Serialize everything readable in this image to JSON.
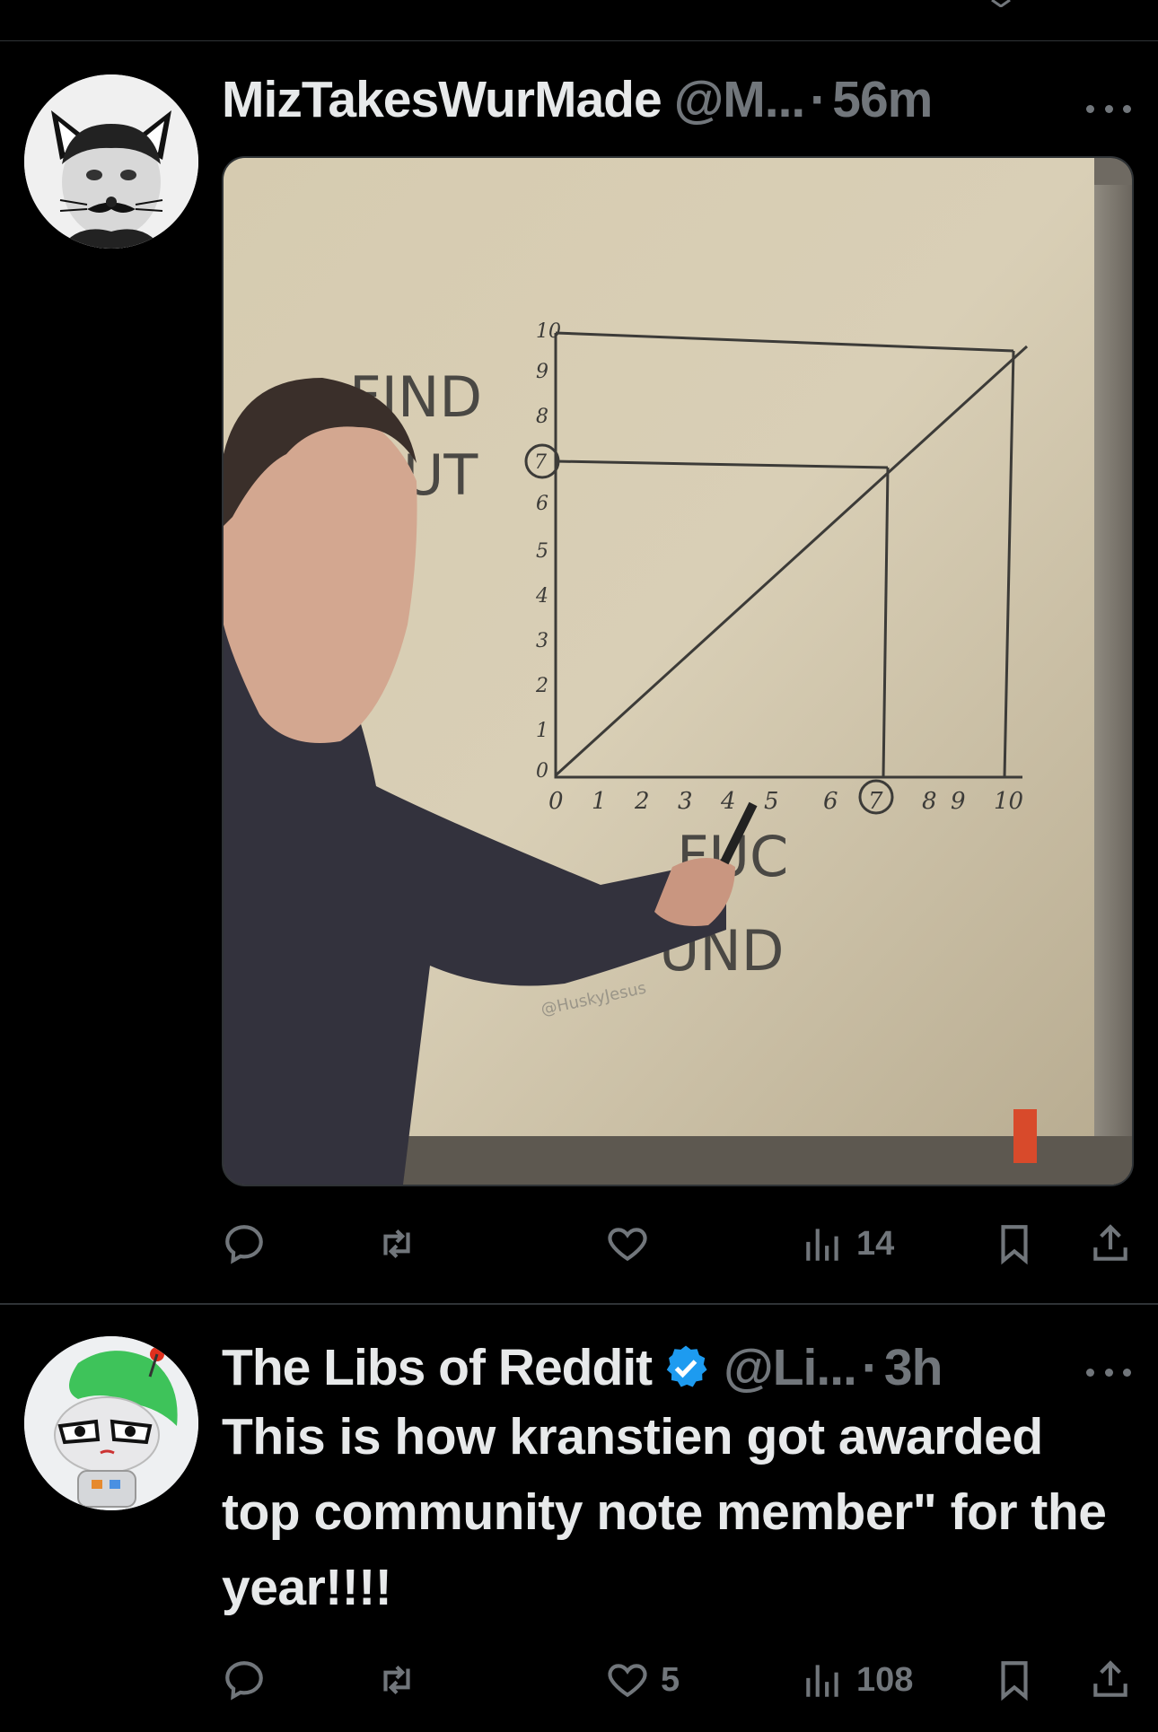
{
  "posts": [
    {
      "display_name": "MizTakesWurMade",
      "handle": "@M...",
      "time": "56m",
      "avatar_icon": "cat-ears-mustache-avatar",
      "media": {
        "board_words": [
          "FIND",
          "UT",
          "FUC",
          "UND"
        ],
        "axis_labels_y": [
          "10",
          "9",
          "8",
          "7",
          "6",
          "5",
          "4",
          "3",
          "2",
          "1",
          "0"
        ],
        "axis_labels_x": [
          "0",
          "1",
          "2",
          "3",
          "4",
          "5",
          "6",
          "7",
          "8",
          "9",
          "10"
        ],
        "watermark": "@HuskyJesus"
      },
      "actions": {
        "reply_count": "",
        "repost_count": "",
        "like_count": "",
        "views_count": "14"
      }
    },
    {
      "display_name": "The Libs of Reddit",
      "verified": true,
      "handle": "@Li...",
      "time": "3h",
      "avatar_icon": "green-hair-robot-avatar",
      "text": "This is how kranstien got awarded top community note member\" for the year!!!!",
      "actions": {
        "reply_count": "",
        "repost_count": "",
        "like_count": "5",
        "views_count": "108"
      }
    }
  ],
  "colors": {
    "background": "#000000",
    "primary_text": "#e7e9ea",
    "secondary_text": "#71767b",
    "divider": "#2f3336",
    "verified_blue": "#1d9bf0"
  }
}
